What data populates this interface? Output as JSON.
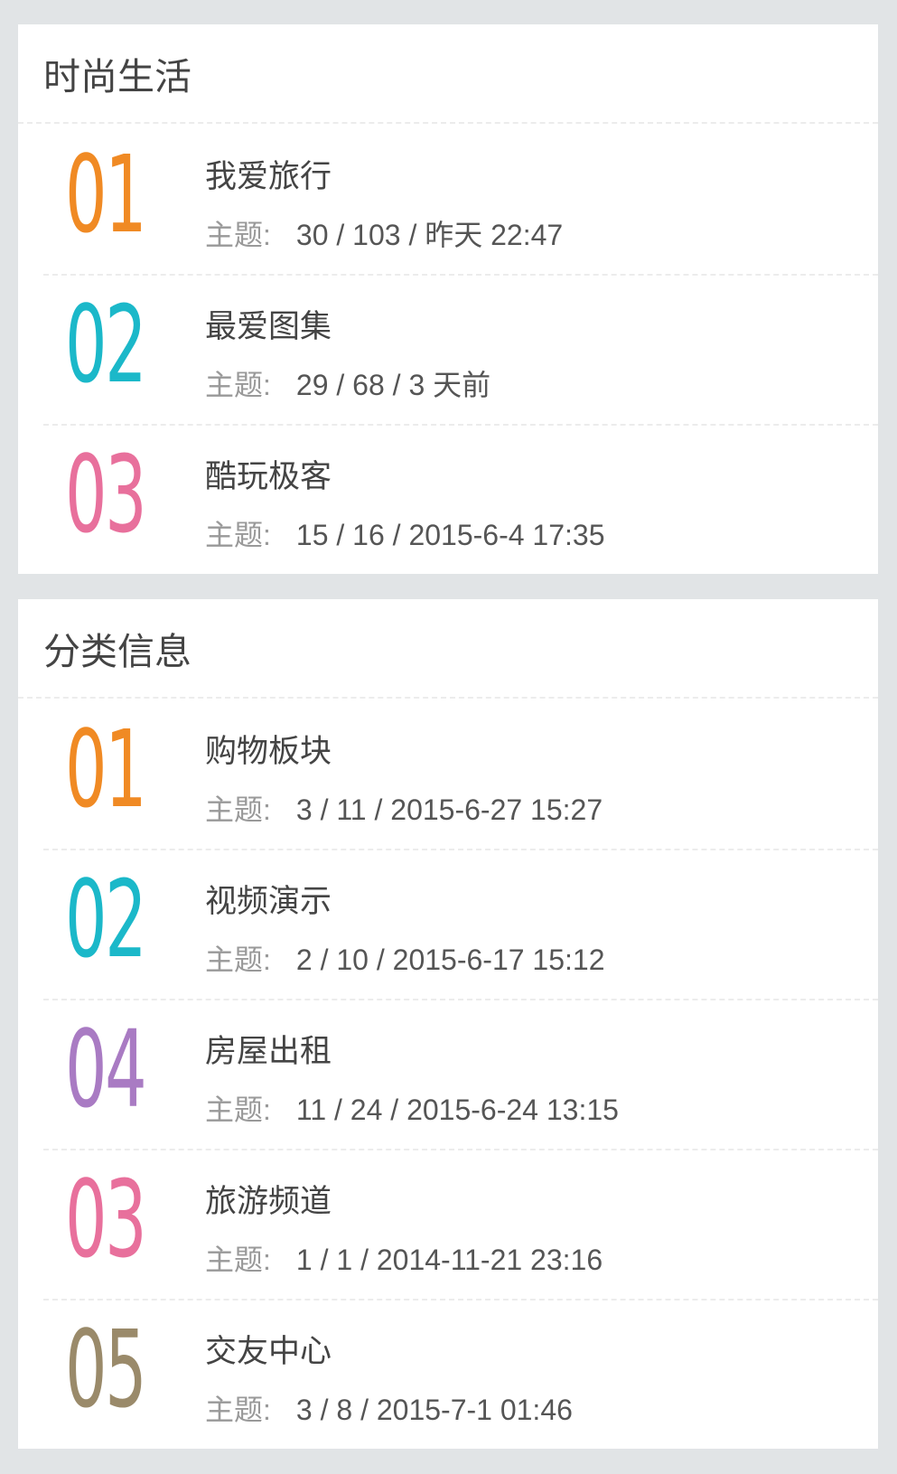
{
  "sections": [
    {
      "title": "时尚生活",
      "items": [
        {
          "num": "01",
          "color": "#f08a24",
          "title": "我爱旅行",
          "label": "主题:",
          "stats": "30 / 103 / 昨天 22:47"
        },
        {
          "num": "02",
          "color": "#1bb8c9",
          "title": "最爱图集",
          "label": "主题:",
          "stats": "29 / 68 / 3 天前"
        },
        {
          "num": "03",
          "color": "#e8709c",
          "title": "酷玩极客",
          "label": "主题:",
          "stats": "15 / 16 / 2015-6-4 17:35"
        }
      ]
    },
    {
      "title": "分类信息",
      "items": [
        {
          "num": "01",
          "color": "#f08a24",
          "title": "购物板块",
          "label": "主题:",
          "stats": "3 / 11 / 2015-6-27 15:27"
        },
        {
          "num": "02",
          "color": "#1bb8c9",
          "title": "视频演示",
          "label": "主题:",
          "stats": "2 / 10 / 2015-6-17 15:12"
        },
        {
          "num": "04",
          "color": "#a97bc3",
          "title": "房屋出租",
          "label": "主题:",
          "stats": "11 / 24 / 2015-6-24 13:15"
        },
        {
          "num": "03",
          "color": "#e8709c",
          "title": "旅游频道",
          "label": "主题:",
          "stats": "1 / 1 / 2014-11-21 23:16"
        },
        {
          "num": "05",
          "color": "#9a8a6a",
          "title": "交友中心",
          "label": "主题:",
          "stats": "3 / 8 / 2015-7-1 01:46"
        }
      ]
    }
  ]
}
